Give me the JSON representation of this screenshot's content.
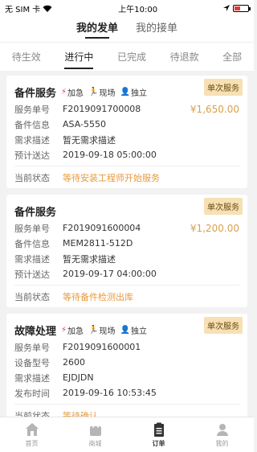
{
  "status_bar": {
    "carrier": "无 SIM 卡",
    "time": "上午10:00"
  },
  "top_tabs": [
    {
      "label": "我的发单",
      "active": true
    },
    {
      "label": "我的接单",
      "active": false
    }
  ],
  "sub_tabs": [
    {
      "label": "待生效",
      "active": false
    },
    {
      "label": "进行中",
      "active": true
    },
    {
      "label": "已完成",
      "active": false
    },
    {
      "label": "待退款",
      "active": false
    },
    {
      "label": "全部",
      "active": false
    }
  ],
  "orders": [
    {
      "title": "备件服务",
      "tag": "单次服务",
      "badges": [
        "加急",
        "现场",
        "独立"
      ],
      "price": "¥1,650.00",
      "rows": [
        {
          "label": "服务单号",
          "value": "F2019091700008"
        },
        {
          "label": "备件信息",
          "value": "ASA-5550"
        },
        {
          "label": "需求描述",
          "value": "暂无需求描述"
        },
        {
          "label": "预计送达",
          "value": "2019-09-18 05:00:00"
        }
      ],
      "status_label": "当前状态",
      "status_value": "等待安装工程师开始服务"
    },
    {
      "title": "备件服务",
      "tag": "单次服务",
      "badges": [],
      "price": "¥1,200.00",
      "rows": [
        {
          "label": "服务单号",
          "value": "F2019091600004"
        },
        {
          "label": "备件信息",
          "value": "MEM2811-512D"
        },
        {
          "label": "需求描述",
          "value": "暂无需求描述"
        },
        {
          "label": "预计送达",
          "value": "2019-09-17 04:00:00"
        }
      ],
      "status_label": "当前状态",
      "status_value": "等待备件检测出库"
    },
    {
      "title": "故障处理",
      "tag": "单次服务",
      "badges": [
        "加急",
        "现场",
        "独立"
      ],
      "price": "",
      "rows": [
        {
          "label": "服务单号",
          "value": "F2019091600001"
        },
        {
          "label": "设备型号",
          "value": "2600"
        },
        {
          "label": "需求描述",
          "value": "EJDJDN"
        },
        {
          "label": "发布时间",
          "value": "2019-09-16 10:53:45"
        }
      ],
      "status_label": "当前状态",
      "status_value": "等待确认"
    }
  ],
  "tabbar": [
    {
      "label": "首页",
      "icon": "home-icon",
      "active": false
    },
    {
      "label": "商城",
      "icon": "bag-icon",
      "active": false
    },
    {
      "label": "订单",
      "icon": "clipboard-icon",
      "active": true
    },
    {
      "label": "我的",
      "icon": "person-icon",
      "active": false
    }
  ],
  "colors": {
    "accent": "#e89a3c",
    "price": "#d9a04a",
    "tag_bg": "#f6e0b4",
    "urgent": "#e53935"
  }
}
